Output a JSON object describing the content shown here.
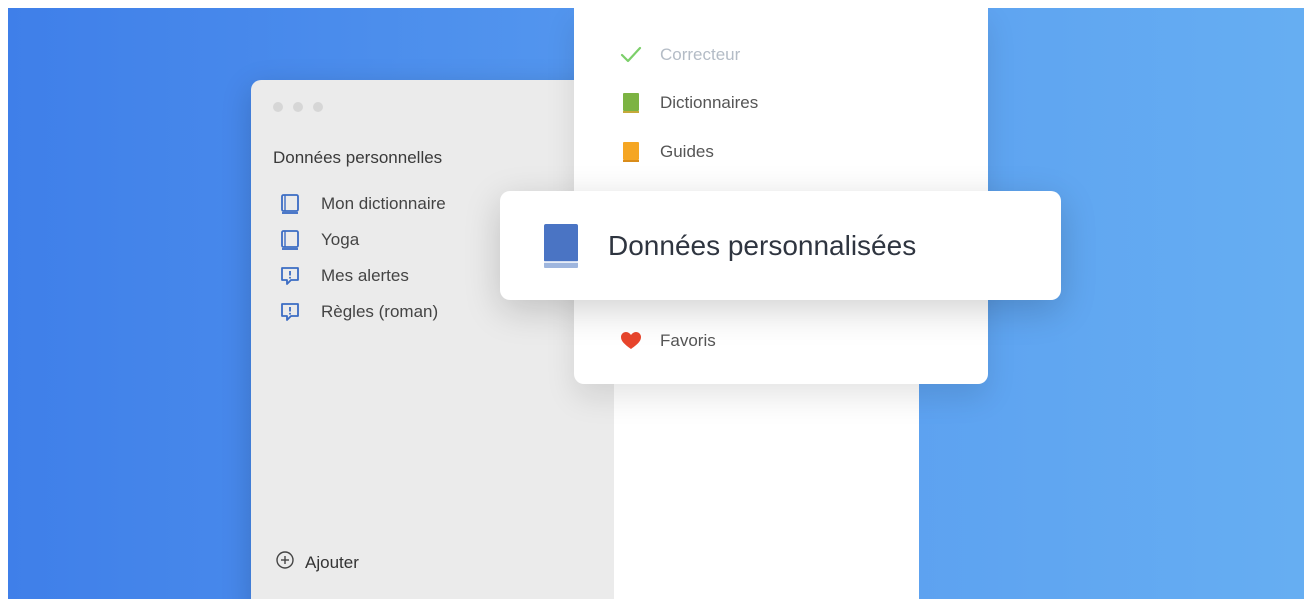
{
  "window": {
    "section_title": "Données personnelles",
    "items": [
      {
        "label": "Mon dictionnaire",
        "icon": "book-outline-icon"
      },
      {
        "label": "Yoga",
        "icon": "book-outline-icon"
      },
      {
        "label": "Mes alertes",
        "icon": "alert-bubble-icon"
      },
      {
        "label": "Règles (roman)",
        "icon": "alert-bubble-icon"
      }
    ],
    "add_label": "Ajouter"
  },
  "menu": {
    "items": [
      {
        "label": "Correcteur",
        "icon": "checkmark-icon",
        "color": "#7ccf6a"
      },
      {
        "label": "Dictionnaires",
        "icon": "green-book-icon",
        "color": "#7cb342"
      },
      {
        "label": "Guides",
        "icon": "orange-book-icon",
        "color": "#f5a623"
      },
      {
        "label": "Favoris",
        "icon": "heart-icon",
        "color": "#e8452c"
      }
    ],
    "highlight": {
      "label": "Données personnalisées",
      "icon": "blue-book-icon",
      "color": "#4a74c4"
    }
  },
  "colors": {
    "background_start": "#3f7fe9",
    "background_end": "#66aef2",
    "accent_blue": "#3b6cc4"
  }
}
